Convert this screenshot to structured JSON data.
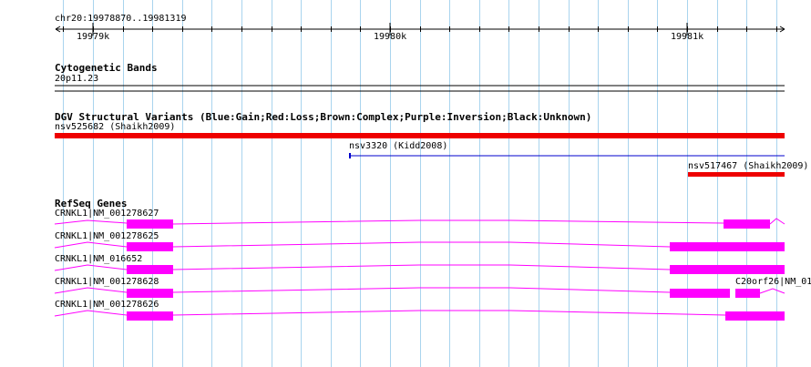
{
  "colors": {
    "grid": "#a9d4ee",
    "ruler": "#000000",
    "variant_gain": "#0000cc",
    "variant_loss": "#ee0000",
    "gene": "#ff00ff"
  },
  "ruler": {
    "location": "chr20:19978870..19981319",
    "ticks": [
      "19979k",
      "19980k",
      "19981k"
    ]
  },
  "tracks": {
    "cytoband": {
      "title": "Cytogenetic Bands",
      "band": "20p11.23"
    },
    "dgv": {
      "title": "DGV Structural Variants (Blue:Gain;Red:Loss;Brown:Complex;Purple:Inversion;Black:Unknown)",
      "features": [
        {
          "label": "nsv525682 (Shaikh2009)",
          "type": "loss"
        },
        {
          "label": "nsv3320 (Kidd2008)",
          "type": "gain"
        },
        {
          "label": "nsv517467 (Shaikh2009)",
          "type": "loss"
        }
      ]
    },
    "refseq": {
      "title": "RefSeq Genes",
      "genes": [
        {
          "label": "CRNKL1|NM_001278627"
        },
        {
          "label": "CRNKL1|NM_001278625"
        },
        {
          "label": "CRNKL1|NM_016652"
        },
        {
          "label": "CRNKL1|NM_001278628"
        },
        {
          "label": "CRNKL1|NM_001278626"
        },
        {
          "label": "C20orf26|NM_01"
        }
      ]
    }
  }
}
